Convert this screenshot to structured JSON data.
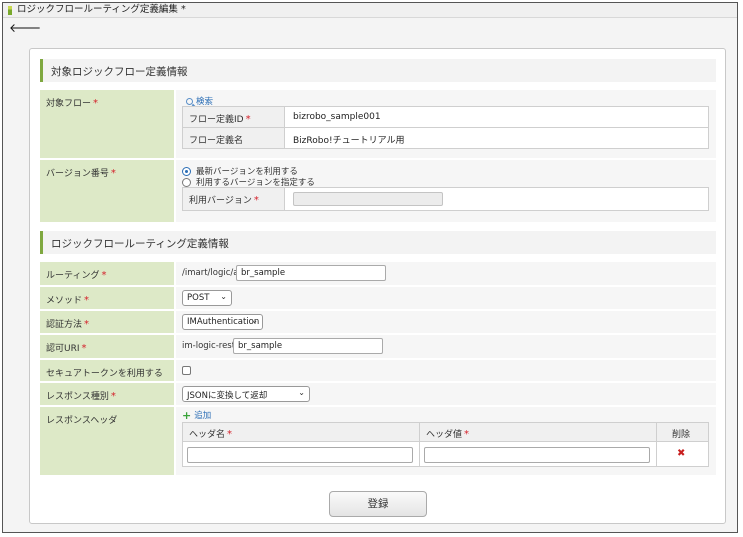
{
  "window": {
    "title": "ロジックフロールーティング定義編集 *"
  },
  "nav": {
    "back_icon": "back-arrow-icon"
  },
  "section1": {
    "title": "対象ロジックフロー定義情報",
    "target_flow": {
      "label": "対象フロー",
      "search_label": "検索",
      "flow_id_label": "フロー定義ID",
      "flow_id_value": "bizrobo_sample001",
      "flow_name_label": "フロー定義名",
      "flow_name_value": "BizRobo!チュートリアル用"
    },
    "version": {
      "label": "バージョン番号",
      "option_latest": "最新バージョンを利用する",
      "option_specify": "利用するバージョンを指定する",
      "use_version_label": "利用バージョン",
      "use_version_value": ""
    }
  },
  "section2": {
    "title": "ロジックフロールーティング定義情報",
    "routing": {
      "label": "ルーティング",
      "prefix": "/imart/logic/api/",
      "value": "br_sample"
    },
    "method": {
      "label": "メソッド",
      "value": "POST"
    },
    "auth": {
      "label": "認証方法",
      "value": "IMAuthentication"
    },
    "auth_uri": {
      "label": "認可URI",
      "prefix": "im-logic-rest://",
      "value": "br_sample"
    },
    "secure_token": {
      "label": "セキュアトークンを利用する",
      "checked": false
    },
    "response_type": {
      "label": "レスポンス種別",
      "value": "JSONに変換して返却"
    },
    "response_header": {
      "label": "レスポンスヘッダ",
      "add_label": "追加",
      "col_name": "ヘッダ名",
      "col_value": "ヘッダ値",
      "col_delete": "削除",
      "rows": [
        {
          "name": "",
          "value": ""
        }
      ]
    }
  },
  "footer": {
    "submit_label": "登録"
  },
  "colors": {
    "accent": "#7fa840",
    "label_bg": "#dde9c7",
    "required": "#d4202a",
    "link": "#2a6db5"
  }
}
